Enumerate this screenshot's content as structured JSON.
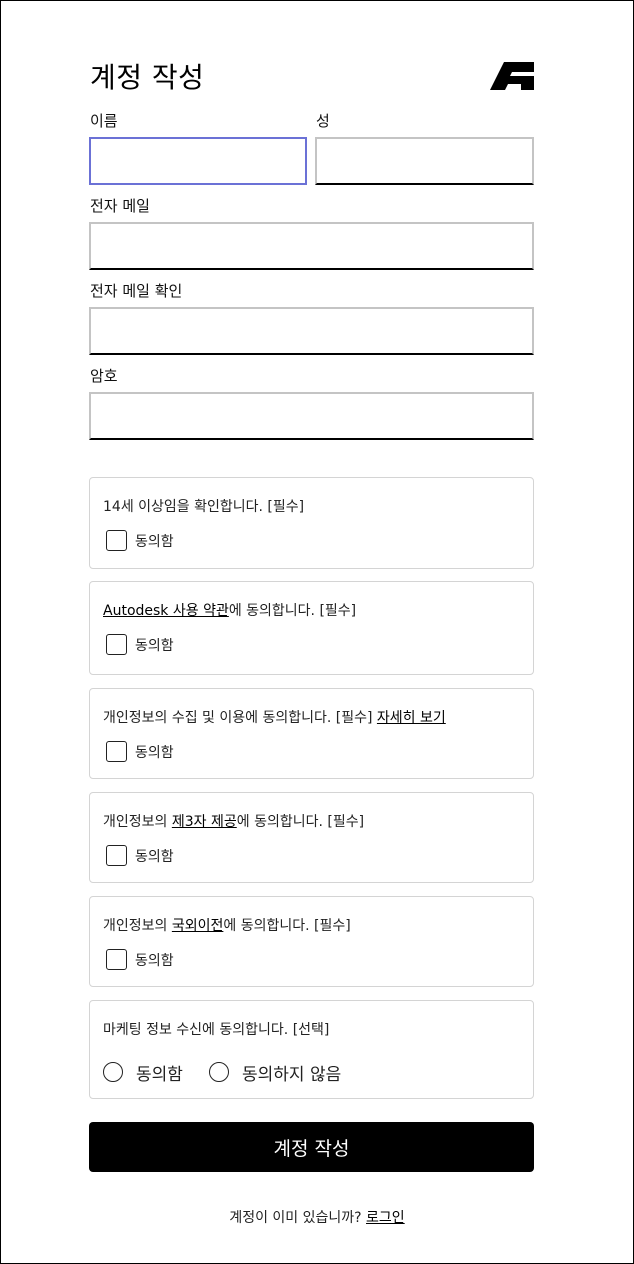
{
  "header": {
    "title": "계정 작성",
    "logo_icon": "autodesk-logo-icon"
  },
  "form": {
    "first_name_label": "이름",
    "last_name_label": "성",
    "email_label": "전자 메일",
    "email_confirm_label": "전자 메일 확인",
    "password_label": "암호",
    "first_name_value": "",
    "last_name_value": "",
    "email_value": "",
    "email_confirm_value": "",
    "password_value": ""
  },
  "consents": [
    {
      "text": "14세 이상임을 확인합니다. [필수]",
      "check_label": "동의함"
    },
    {
      "link": "Autodesk 사용 약관",
      "text": "에 동의합니다. [필수]",
      "check_label": "동의함"
    },
    {
      "text": "개인정보의 수집 및 이용에 동의합니다. [필수] ",
      "link": "자세히 보기",
      "check_label": "동의함"
    },
    {
      "prefix": "개인정보의 ",
      "link": "제3자 제공",
      "text": "에 동의합니다. [필수]",
      "check_label": "동의함"
    },
    {
      "prefix": "개인정보의 ",
      "link": "국외이전",
      "text": "에 동의합니다. [필수]",
      "check_label": "동의함"
    }
  ],
  "marketing": {
    "text": "마케팅 정보 수신에 동의합니다. [선택]",
    "agree_label": "동의함",
    "disagree_label": "동의하지 않음"
  },
  "submit_label": "계정 작성",
  "footer": {
    "text": "계정이 이미 있습니까? ",
    "login_link": "로그인"
  },
  "colors": {
    "focus_border": "#6b71d6",
    "button_bg": "#000000",
    "card_border": "#d4d4d4"
  }
}
